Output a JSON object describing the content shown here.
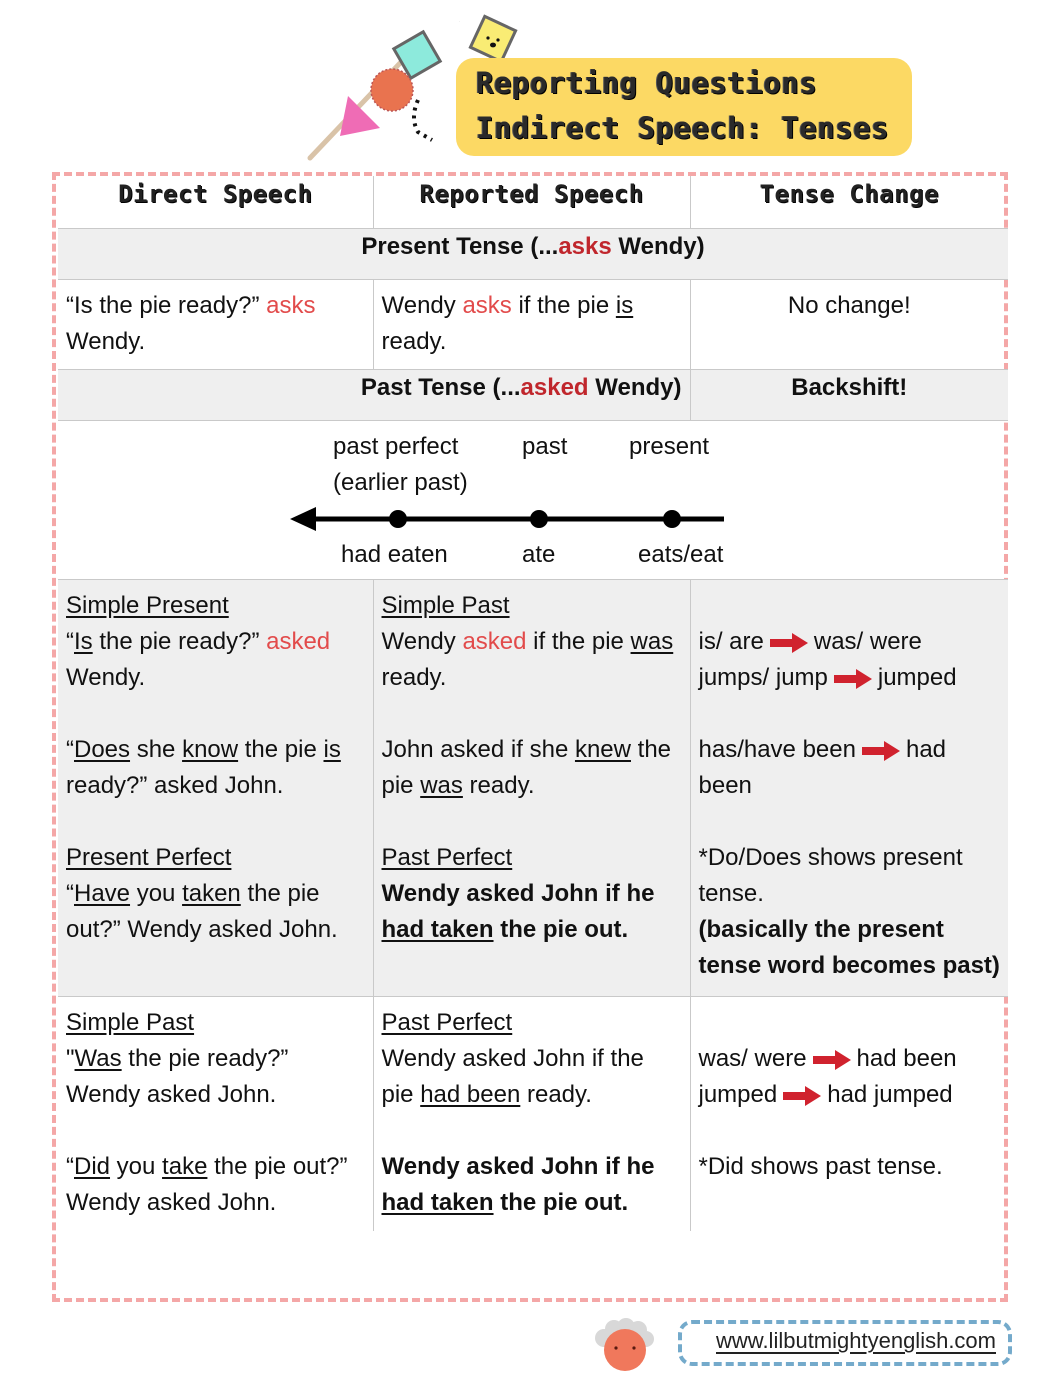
{
  "header": {
    "title_line1": "Reporting Questions",
    "title_line2": "Indirect Speech: Tenses",
    "title_bg": "#fcd964"
  },
  "columns": [
    "Direct Speech",
    "Reported Speech",
    "Tense Change"
  ],
  "present_section": {
    "band_prefix": "Present Tense (...",
    "band_verb": "asks",
    "band_suffix": " Wendy)",
    "direct": {
      "quote": "“Is the pie ready?” ",
      "verb": "asks",
      "rest": " Wendy."
    },
    "reported": {
      "pre": "Wendy ",
      "verb": "asks",
      "mid": " if the pie ",
      "underlined": "is",
      "post": " ready."
    },
    "change": "No change!"
  },
  "past_section": {
    "band_prefix": "Past Tense (...",
    "band_verb": "asked",
    "band_suffix": " Wendy)",
    "band_right": "Backshift!"
  },
  "timeline": {
    "top_labels": [
      "past perfect",
      "(earlier past)",
      "past",
      "present"
    ],
    "bottom_labels": [
      "had eaten",
      "ate",
      "eats/eat"
    ]
  },
  "rows": {
    "simple_present": {
      "direct_heading": "Simple Present",
      "direct_1": {
        "open": "“",
        "u1": "Is",
        "mid": " the pie ready?” ",
        "verb": "asked",
        "end": " Wendy."
      },
      "direct_2": {
        "open": "“",
        "u1": "Does",
        "mid1": " she ",
        "u2": "know",
        "mid2": " the pie ",
        "u3": "is",
        "end": " ready?” asked John."
      },
      "reported_heading": "Simple Past",
      "reported_1": {
        "pre": "Wendy ",
        "verb": "asked",
        "mid": " if the pie ",
        "u1": "was",
        "end": " ready."
      },
      "reported_2": {
        "pre": "John asked if she ",
        "u1": "knew",
        "mid": " the pie ",
        "u2": "was",
        "end": " ready."
      },
      "changes": [
        {
          "from": "is/ are",
          "to": "was/ were"
        },
        {
          "from": "jumps/ jump",
          "to": "jumped"
        },
        {
          "from": "has/have been",
          "to": "had been"
        }
      ]
    },
    "present_perfect": {
      "direct_heading": "Present Perfect",
      "direct": {
        "open": "“",
        "u1": "Have",
        "mid1": " you ",
        "u2": "taken",
        "end": " the pie out?” Wendy asked John."
      },
      "reported_heading": "Past Perfect",
      "reported": {
        "pre": "Wendy asked John if he ",
        "u1": "had taken",
        "end": " the pie out."
      },
      "note": "*Do/Does shows present tense.",
      "note_bold": "(basically the present tense word becomes past)"
    },
    "simple_past": {
      "direct_heading": "Simple Past",
      "direct_1": {
        "open": "\"",
        "u1": "Was",
        "end": " the pie ready?” Wendy asked John."
      },
      "direct_2": {
        "open": "“",
        "u1": "Did",
        "mid1": " you ",
        "u2": "take",
        "end": " the pie out?” Wendy asked John."
      },
      "reported_heading": "Past Perfect",
      "reported_1": {
        "pre": "Wendy asked John if the pie ",
        "u1": "had been",
        "end": " ready."
      },
      "reported_2": {
        "pre": "Wendy asked John if he ",
        "u1": "had taken",
        "end": " the pie out."
      },
      "changes": [
        {
          "from": "was/ were",
          "to": "had been"
        },
        {
          "from": "jumped",
          "to": "had jumped"
        }
      ],
      "note": "*Did shows past tense."
    }
  },
  "colors": {
    "accent_red": "#e24b4b",
    "band_red": "#c0262c",
    "arrow_red": "#d0222e",
    "frame_pink": "#f4a7a7",
    "footer_blue": "#74aacb"
  },
  "footer": {
    "url": "www.lilbutmightyenglish.com"
  }
}
